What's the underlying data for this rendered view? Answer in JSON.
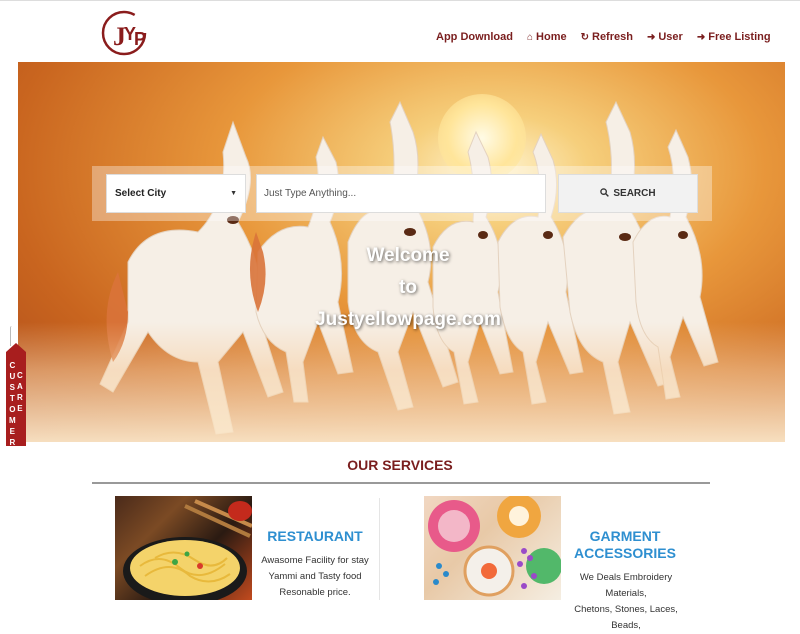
{
  "header": {
    "logo_text": "JYP",
    "nav": [
      {
        "label": "App Download",
        "icon": ""
      },
      {
        "label": "Home",
        "icon": "home-icon"
      },
      {
        "label": "Refresh",
        "icon": "refresh-icon"
      },
      {
        "label": "User",
        "icon": "sign-in-icon"
      },
      {
        "label": "Free Listing",
        "icon": "sign-in-icon"
      }
    ]
  },
  "hero": {
    "city_select_value": "Select City",
    "search_placeholder": "Just Type Anything...",
    "search_button_label": "SEARCH",
    "welcome_line1": "Welcome",
    "welcome_line2": "to",
    "welcome_line3": "Justyellowpage.com"
  },
  "customer_care": {
    "line1": "CUSTOMER",
    "line2": "CARE"
  },
  "services": {
    "title": "OUR SERVICES",
    "items": [
      {
        "title": "RESTAURANT",
        "desc_lines": [
          "Awasome Facility for stay",
          "Yammi and Tasty food",
          "Resonable price."
        ]
      },
      {
        "title_line1": "GARMENT",
        "title_line2": "ACCESSORIES",
        "desc_lines": [
          "We Deals Embroidery Materials,",
          "Chetons, Stones, Laces, Beads,"
        ]
      }
    ]
  },
  "colors": {
    "brand": "#7a1e1e",
    "accent_blue": "#2e8fd0",
    "care_tag": "#a81e1e"
  }
}
